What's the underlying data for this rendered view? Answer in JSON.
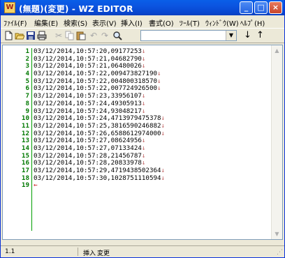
{
  "window": {
    "title": "(無題)(変更) - WZ EDITOR",
    "app_icon_glyph": "W",
    "controls": {
      "minimize": "_",
      "maximize": "□",
      "close": "×"
    }
  },
  "menu": [
    "ﾌｧｲﾙ(F)",
    "編集(E)",
    "検索(S)",
    "表示(V)",
    "挿入(I)",
    "書式(O)",
    "ﾂｰﾙ(T)",
    "ｳｨﾝﾄﾞｳ(W)",
    "ﾍﾙﾌﾟ(H)"
  ],
  "toolbar": {
    "icons": [
      "new-file-icon",
      "open-folder-icon",
      "save-icon",
      "print-icon",
      "cut-icon",
      "copy-icon",
      "paste-icon",
      "undo-icon",
      "redo-icon",
      "search-icon"
    ],
    "search_value": "",
    "down_arrow": "↓",
    "up_arrow": "↑"
  },
  "editor": {
    "lines": [
      "03/12/2014,10:57:20,09177253↓",
      "03/12/2014,10:57:21,04682790↓",
      "03/12/2014,10:57:21,06480026↓",
      "03/12/2014,10:57:22,009473827190↓",
      "03/12/2014,10:57:22,004800318570↓",
      "03/12/2014,10:57:22,007724926500↓",
      "03/12/2014,10:57:23,33956107↓",
      "03/12/2014,10:57:24,49305913↓",
      "03/12/2014,10:57:24,93048217↓",
      "03/12/2014,10:57:24,4713979475378↓",
      "03/12/2014,10:57:25,3816590246882↓",
      "03/12/2014,10:57:26,6588612974000↓",
      "03/12/2014,10:57:27,08624956↓",
      "03/12/2014,10:57:27,07133424↓",
      "03/12/2014,10:57:28,21456787↓",
      "03/12/2014,10:57:28,20833978↓",
      "03/12/2014,10:57:29,4719438502364↓",
      "03/12/2014,10:57:30,1028751110594↓",
      "←"
    ]
  },
  "status": {
    "position": "1.1",
    "mode": "挿入",
    "modified": "変更"
  }
}
